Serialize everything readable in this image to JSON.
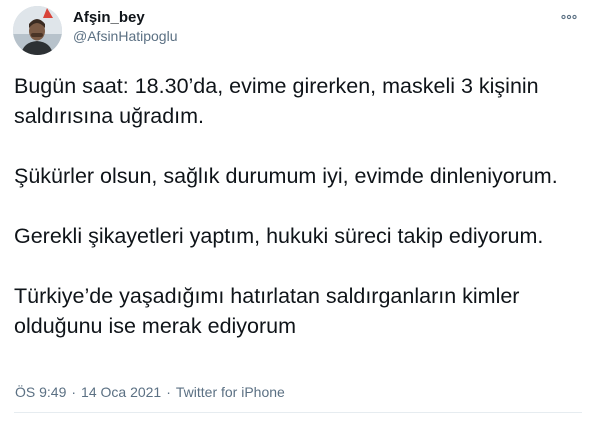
{
  "author": {
    "display_name": "Afşin_bey",
    "handle": "@AfsinHatipoglu"
  },
  "tweet": {
    "paragraphs": [
      "Bugün saat: 18.30’da, evime girerken, maskeli 3 kişinin saldırısına uğradım.",
      "Şükürler olsun, sağlık durumum  iyi, evimde dinleniyorum.",
      "Gerekli şikayetleri yaptım, hukuki süreci takip ediyorum.",
      "Türkiye’de yaşadığımı hatırlatan saldırganların kimler olduğunu ise merak ediyorum"
    ]
  },
  "meta": {
    "time": "ÖS 9:49",
    "separator": "·",
    "date": "14 Oca 2021",
    "source": "Twitter for iPhone"
  },
  "icons": {
    "more": "more-horizontal-icon",
    "avatar": "avatar-photo"
  },
  "colors": {
    "text": "#0f1419",
    "secondary": "#5b7083",
    "divider": "#e6ecf0"
  }
}
